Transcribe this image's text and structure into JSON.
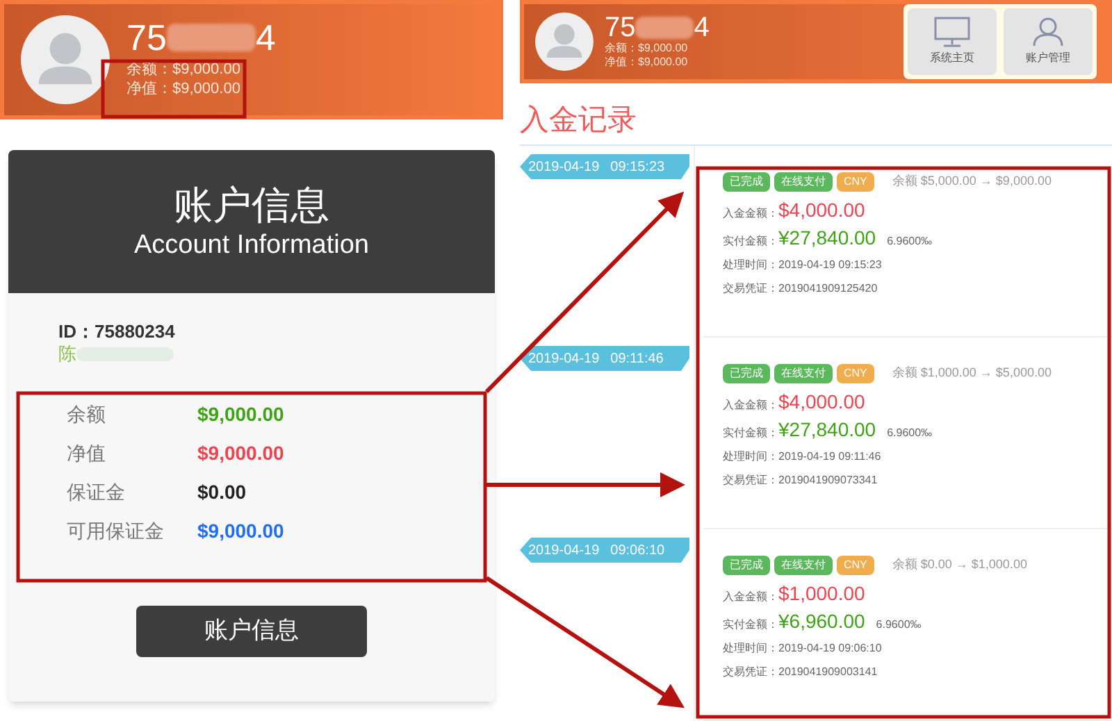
{
  "left_header": {
    "id_prefix": "75",
    "id_suffix": "4",
    "balance": "余额：$9,000.00",
    "equity": "净值：$9,000.00"
  },
  "account_card": {
    "title": "账户信息",
    "subtitle": "Account Information",
    "id": "ID：75880234",
    "name": "陈",
    "rows": [
      {
        "label": "余额",
        "value": "$9,000.00",
        "color": "#3fa316"
      },
      {
        "label": "净值",
        "value": "$9,000.00",
        "color": "#f0434f"
      },
      {
        "label": "保证金",
        "value": "$0.00",
        "color": "#222222"
      },
      {
        "label": "可用保证金",
        "value": "$9,000.00",
        "color": "#1f6ff5"
      }
    ],
    "button": "账户信息"
  },
  "right_header": {
    "id_prefix": "75",
    "id_suffix": "4",
    "balance": "余额：$9,000.00",
    "equity": "净值：$9,000.00",
    "nav": [
      {
        "label": "系统主页",
        "kind": "monitor"
      },
      {
        "label": "账户管理",
        "kind": "user"
      }
    ]
  },
  "section_title": "入金记录",
  "records": [
    {
      "date": "2019-04-19",
      "time": "09:15:23",
      "tags": [
        {
          "label": "已完成",
          "color": "#5cb85c"
        },
        {
          "label": "在线支付",
          "color": "#5cb85c"
        },
        {
          "label": "CNY",
          "color": "#f0ad4e"
        }
      ],
      "balance_change": "余额 $5,000.00 → $9,000.00",
      "deposit_label": "入金金额：",
      "deposit": "$4,000.00",
      "paid_label": "实付金额：",
      "paid": "¥27,840.00",
      "rate": "6.9600‰",
      "processed": "处理时间：2019-04-19 09:15:23",
      "voucher": "交易凭证：2019041909125420"
    },
    {
      "date": "2019-04-19",
      "time": "09:11:46",
      "tags": [
        {
          "label": "已完成",
          "color": "#5cb85c"
        },
        {
          "label": "在线支付",
          "color": "#5cb85c"
        },
        {
          "label": "CNY",
          "color": "#f0ad4e"
        }
      ],
      "balance_change": "余额 $1,000.00 → $5,000.00",
      "deposit_label": "入金金额：",
      "deposit": "$4,000.00",
      "paid_label": "实付金额：",
      "paid": "¥27,840.00",
      "rate": "6.9600‰",
      "processed": "处理时间：2019-04-19 09:11:46",
      "voucher": "交易凭证：2019041909073341"
    },
    {
      "date": "2019-04-19",
      "time": "09:06:10",
      "tags": [
        {
          "label": "已完成",
          "color": "#5cb85c"
        },
        {
          "label": "在线支付",
          "color": "#5cb85c"
        },
        {
          "label": "CNY",
          "color": "#f0ad4e"
        }
      ],
      "balance_change": "余额 $0.00 → $1,000.00",
      "deposit_label": "入金金额：",
      "deposit": "$1,000.00",
      "paid_label": "实付金额：",
      "paid": "¥6,960.00",
      "rate": "6.9600‰",
      "processed": "处理时间：2019-04-19 09:06:10",
      "voucher": "交易凭证：2019041909003141"
    }
  ]
}
